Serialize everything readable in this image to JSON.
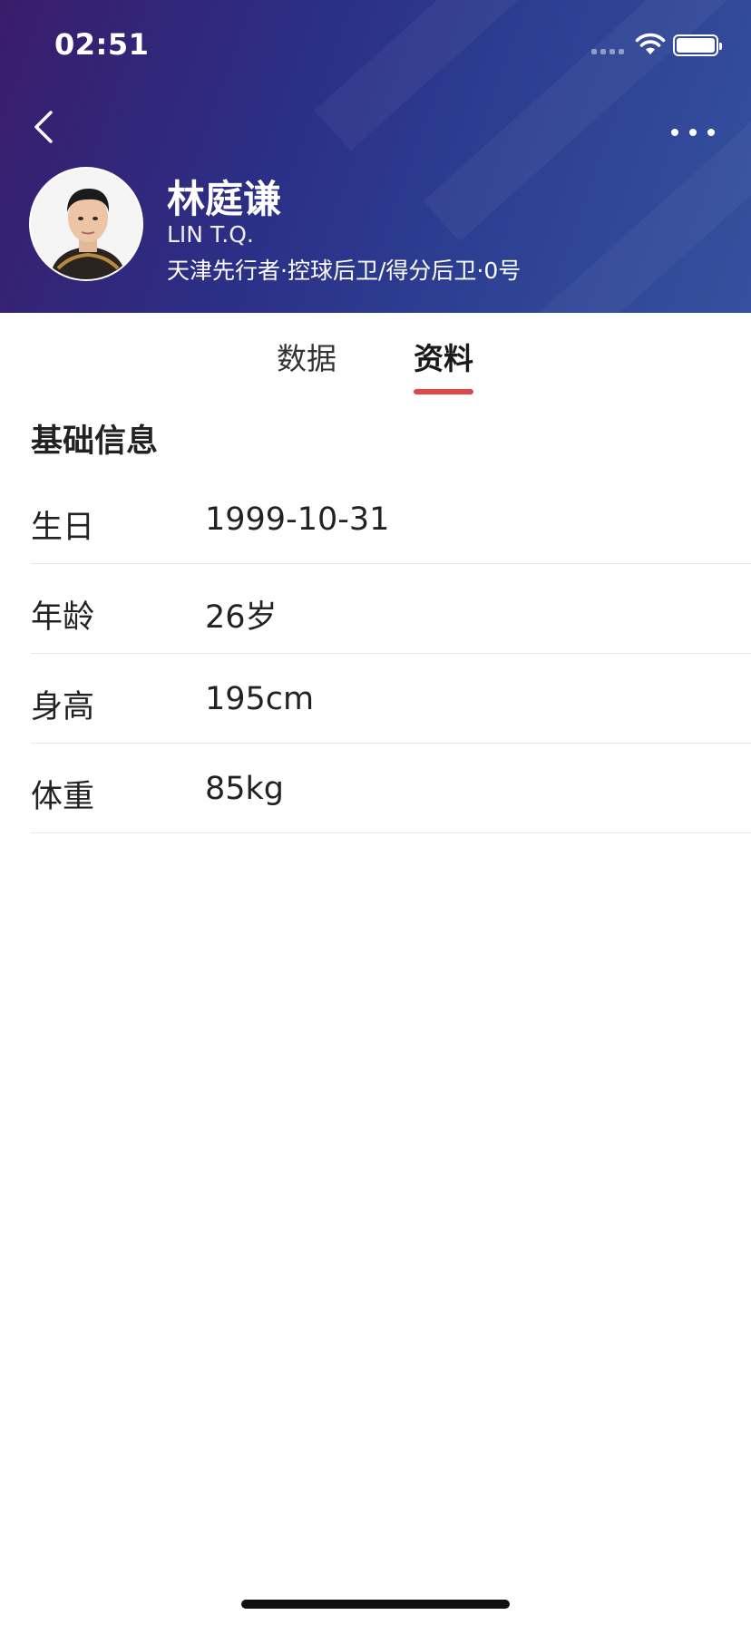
{
  "status_bar": {
    "time": "02:51"
  },
  "header": {
    "player_name": "林庭谦",
    "player_name_en": "LIN T.Q.",
    "player_meta": "天津先行者·控球后卫/得分后卫·0号",
    "back_icon": "chevron-left-icon",
    "more_icon": "more-horizontal-icon"
  },
  "tabs": [
    {
      "label": "数据",
      "active": false
    },
    {
      "label": "资料",
      "active": true
    }
  ],
  "section": {
    "title": "基础信息",
    "rows": [
      {
        "label": "生日",
        "value": "1999-10-31"
      },
      {
        "label": "年龄",
        "value": "26岁"
      },
      {
        "label": "身高",
        "value": "195cm"
      },
      {
        "label": "体重",
        "value": "85kg"
      }
    ]
  },
  "colors": {
    "header_gradient_start": "#3a1c6b",
    "header_gradient_end": "#35519e",
    "tab_indicator": "#e04848"
  }
}
